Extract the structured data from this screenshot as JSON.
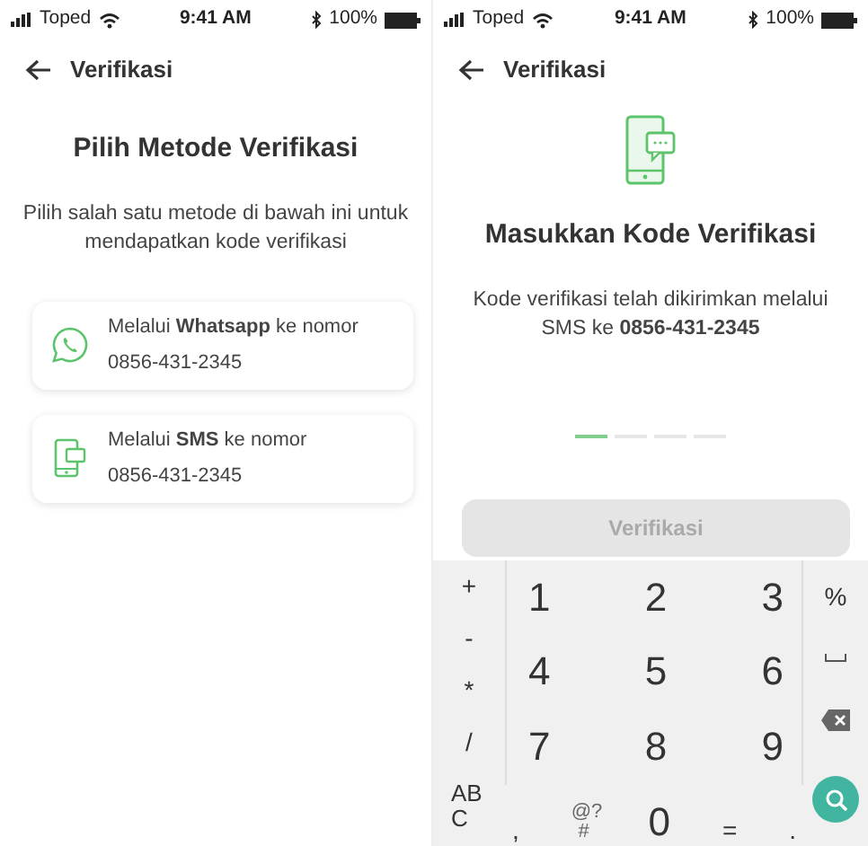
{
  "left_screen": {
    "status_bar": {
      "carrier": "Toped",
      "time": "9:41 AM",
      "battery": "100%"
    },
    "header": {
      "title": "Verifikasi"
    },
    "title": "Pilih Metode Verifikasi",
    "subtitle": "Pilih salah satu metode di bawah ini untuk mendapatkan kode verifikasi",
    "options": [
      {
        "kind": "whatsapp",
        "label": "Melalui **Whatsapp** ke nomor",
        "number": "0856-431-2345"
      },
      {
        "kind": "sms",
        "label": "Melalui **SMS** ke nomor",
        "number": "0856-431-2345"
      }
    ]
  },
  "right_screen": {
    "status_bar": {
      "carrier": "Toped",
      "time": "9:41 AM",
      "battery": "100%"
    },
    "header": {
      "title": "Verifikasi"
    },
    "title": "Masukkan Kode Verifikasi",
    "subtitle": "Kode verifikasi telah dikirimkan melalui SMS ke **0856-431-2345**",
    "code_slots": [
      {
        "active": true
      },
      {
        "active": false
      },
      {
        "active": false
      },
      {
        "active": false
      }
    ],
    "button": {
      "label": "Verifikasi",
      "disabled": true
    },
    "keyboard": {
      "symbols": [
        "+",
        "-",
        "*",
        "/",
        "AB C"
      ],
      "digit_rows": [
        [
          "1",
          "2",
          "3"
        ],
        [
          "4",
          "5",
          "6"
        ],
        [
          "7",
          "8",
          "9"
        ]
      ],
      "bottom_row": [
        ",",
        "@? #",
        "0",
        "=",
        "."
      ],
      "side_keys": [
        {
          "kind": "text",
          "label": "%"
        },
        {
          "kind": "space"
        },
        {
          "kind": "backspace"
        },
        {
          "kind": "search"
        }
      ]
    }
  }
}
